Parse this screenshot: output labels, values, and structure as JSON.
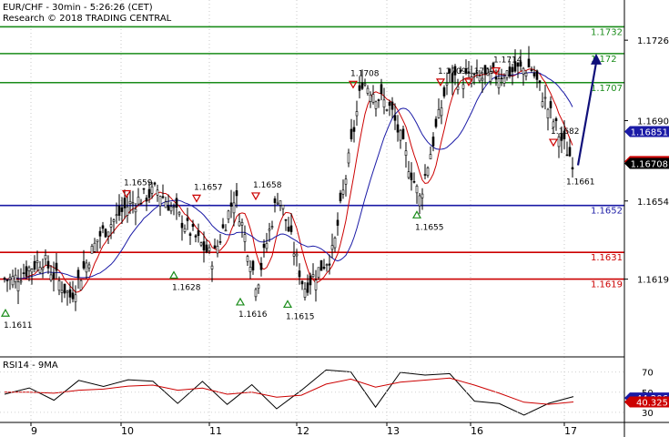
{
  "header": {
    "line1": "EUR/CHF - 30min - 5:26:26 (CET)",
    "line2": "Research © 2018 TRADING CENTRAL"
  },
  "colors": {
    "candle": "#000000",
    "ma_fast": "#cc0000",
    "ma_slow": "#1a1aa6",
    "resistance": "#1a8c1a",
    "support": "#cc0000",
    "pivot": "#1a1aa6",
    "projection": "#10107a",
    "tag_blue": "#1a1aa6",
    "tag_red": "#cc0000",
    "tag_black": "#000000"
  },
  "chart_data": [
    {
      "type": "candlestick",
      "title": "EUR/CHF - 30min",
      "x_ticks": [
        "9",
        "10",
        "11",
        "12",
        "13",
        "16",
        "17"
      ],
      "y_ticks": [
        1.1619,
        1.1654,
        1.169,
        1.1726
      ],
      "ylim": [
        1.1585,
        1.1744
      ],
      "price_path": [
        {
          "x": "9",
          "close": 1.1619
        },
        {
          "x": "9",
          "close": 1.1628
        },
        {
          "x": "9",
          "close": 1.1611
        },
        {
          "x": "9",
          "close": 1.1638
        },
        {
          "x": "10",
          "close": 1.1652
        },
        {
          "x": "10",
          "close": 1.1659
        },
        {
          "x": "10",
          "close": 1.1642
        },
        {
          "x": "11",
          "close": 1.1628
        },
        {
          "x": "11",
          "close": 1.1657
        },
        {
          "x": "11",
          "close": 1.1616
        },
        {
          "x": "11",
          "close": 1.1658
        },
        {
          "x": "12",
          "close": 1.1615
        },
        {
          "x": "12",
          "close": 1.1631
        },
        {
          "x": "12",
          "close": 1.1708
        },
        {
          "x": "13",
          "close": 1.1695
        },
        {
          "x": "13",
          "close": 1.1655
        },
        {
          "x": "13",
          "close": 1.1709
        },
        {
          "x": "16",
          "close": 1.1709
        },
        {
          "x": "16",
          "close": 1.1714
        },
        {
          "x": "17",
          "close": 1.1682
        },
        {
          "x": "17",
          "close": 1.167
        }
      ],
      "horizontal_levels": [
        {
          "value": 1.1732,
          "label": "1.1732",
          "role": "resistance"
        },
        {
          "value": 1.172,
          "label": "1.172",
          "role": "resistance"
        },
        {
          "value": 1.1707,
          "label": "1.1707",
          "role": "resistance"
        },
        {
          "value": 1.1652,
          "label": "1.1652",
          "role": "pivot"
        },
        {
          "value": 1.1631,
          "label": "1.1631",
          "role": "support"
        },
        {
          "value": 1.1619,
          "label": "1.1619",
          "role": "support"
        }
      ],
      "price_tags": [
        {
          "value": 1.16851,
          "label": "1.16851",
          "style": "blue"
        },
        {
          "value": 1.16717,
          "label": "1.16717",
          "style": "red"
        },
        {
          "value": 1.16708,
          "label": "1.16708",
          "style": "black"
        }
      ],
      "annotations": [
        {
          "x": "9",
          "value": 1.1611,
          "label": "1.1611",
          "marker": "up"
        },
        {
          "x": "10",
          "value": 1.1659,
          "label": "1.1659",
          "marker": "down"
        },
        {
          "x": "11",
          "value": 1.1628,
          "label": "1.1628",
          "marker": "up"
        },
        {
          "x": "11",
          "value": 1.1657,
          "label": "1.1657",
          "marker": "down"
        },
        {
          "x": "11",
          "value": 1.1616,
          "label": "1.1616",
          "marker": "up"
        },
        {
          "x": "11",
          "value": 1.1658,
          "label": "1.1658",
          "marker": "down"
        },
        {
          "x": "12",
          "value": 1.1615,
          "label": "1.1615",
          "marker": "up"
        },
        {
          "x": "12",
          "value": 1.1708,
          "label": "1.1708",
          "marker": "down"
        },
        {
          "x": "13",
          "value": 1.1655,
          "label": "1.1655",
          "marker": "up"
        },
        {
          "x": "13",
          "value": 1.1709,
          "label": "1.1709",
          "marker": "down"
        },
        {
          "x": "16",
          "value": 1.1709,
          "label": "1.1709",
          "marker": "down"
        },
        {
          "x": "16",
          "value": 1.1714,
          "label": "1.1714",
          "marker": "down"
        },
        {
          "x": "17",
          "value": 1.1682,
          "label": "1.1682",
          "marker": "down"
        },
        {
          "x": "17",
          "value": 1.1661,
          "label": "1.1661",
          "marker": "none"
        }
      ],
      "projection": {
        "from": 1.167,
        "to": 1.172,
        "direction": "up"
      }
    },
    {
      "type": "line",
      "title": "RSI14 - 9MA",
      "x_ticks": [
        "9",
        "10",
        "11",
        "12",
        "13",
        "16",
        "17"
      ],
      "y_ticks": [
        70,
        50,
        30
      ],
      "ylim": [
        20,
        85
      ],
      "series": [
        {
          "name": "RSI14",
          "role": "rsi",
          "values": [
            48,
            52,
            45,
            60,
            55,
            65,
            58,
            40,
            62,
            35,
            60,
            33,
            50,
            75,
            68,
            35,
            72,
            64,
            70,
            42,
            36,
            30,
            38,
            44.206
          ]
        },
        {
          "name": "9MA",
          "role": "ma",
          "values": [
            50,
            50,
            49,
            52,
            53,
            56,
            57,
            52,
            54,
            48,
            50,
            45,
            47,
            58,
            63,
            55,
            60,
            62,
            64,
            57,
            49,
            40,
            38,
            40.325
          ]
        }
      ],
      "price_tags": [
        {
          "value": 44.206,
          "label": "44.206",
          "style": "blue"
        },
        {
          "value": 40.325,
          "label": "40.325",
          "style": "red"
        }
      ]
    }
  ]
}
